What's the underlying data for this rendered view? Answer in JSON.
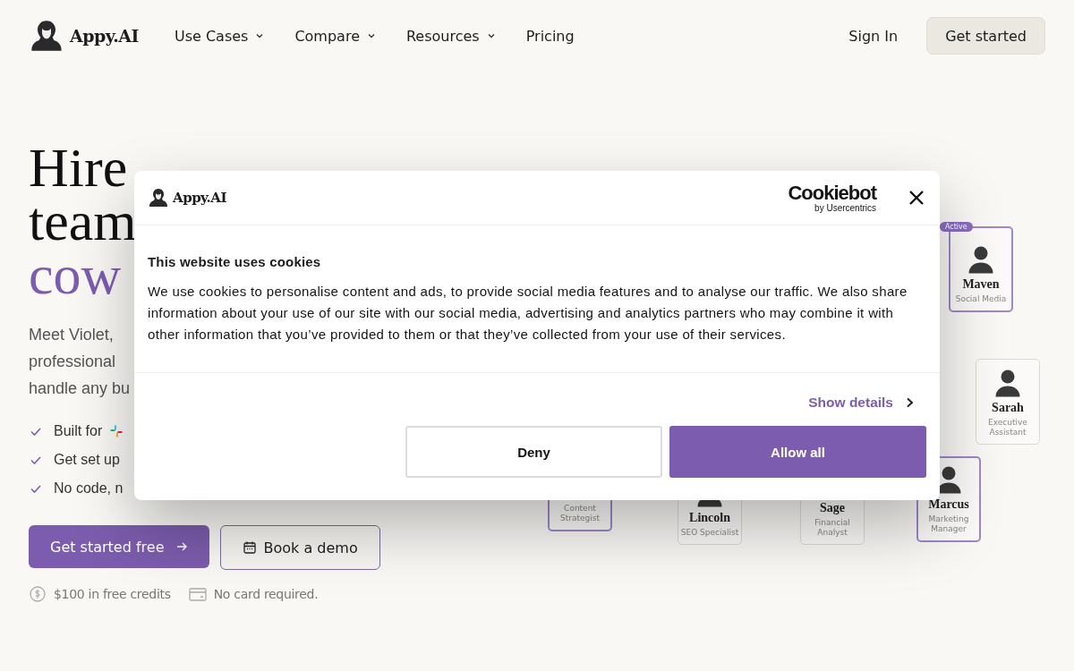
{
  "nav": {
    "logo": "Appy.AI",
    "links": [
      {
        "label": "Use Cases",
        "dropdown": true
      },
      {
        "label": "Compare",
        "dropdown": true
      },
      {
        "label": "Resources",
        "dropdown": true
      },
      {
        "label": "Pricing",
        "dropdown": false
      }
    ],
    "sign_in": "Sign In",
    "cta": "Get started"
  },
  "hero": {
    "heading_lines": [
      {
        "text": "Hire",
        "accent": false
      },
      {
        "text": "team",
        "accent": false
      },
      {
        "text": "cow",
        "accent": true
      }
    ],
    "intro_lines": [
      "Meet Violet,",
      "professional",
      "handle any bu"
    ],
    "checks": [
      {
        "text": "Built for",
        "kind": "slack"
      },
      {
        "text": "Get set up",
        "kind": "plain"
      },
      {
        "text": "No code, n",
        "kind": "plain"
      }
    ],
    "primary_button": "Get started free",
    "secondary_button": "Book a demo",
    "perks": [
      {
        "kind": "dollar",
        "text": "$100 in free credits"
      },
      {
        "kind": "card",
        "text": "No card required."
      }
    ]
  },
  "team": [
    {
      "name": "Maven",
      "role": "Social Media",
      "badge": "Active",
      "highlighted": true
    },
    {
      "name": "Sarah",
      "role": "Executive Assistant",
      "highlighted": false
    },
    {
      "role": "Content Strategist",
      "highlighted": true
    },
    {
      "name": "Lincoln",
      "role": "SEO Specialist",
      "highlighted": false
    },
    {
      "name": "Sage",
      "role": "Financial Analyst",
      "highlighted": false
    },
    {
      "name": "Marcus",
      "role": "Marketing Manager",
      "highlighted": true
    }
  ],
  "cookie_dialog": {
    "logo": "Appy.AI",
    "brand": "Cookiebot",
    "brand_sub": "by Usercentrics",
    "title": "This website uses cookies",
    "body": "We use cookies to personalise content and ads, to provide social media features and to analyse our traffic. We also share information about your use of our site with our social media, advertising and analytics partners who may combine it with other information that you’ve provided to them or that they’ve collected from your use of their services.",
    "details_link": "Show details",
    "buttons": [
      {
        "label": "Deny",
        "kind": "outline"
      },
      {
        "label": "Allow all",
        "kind": "filled"
      }
    ]
  }
}
